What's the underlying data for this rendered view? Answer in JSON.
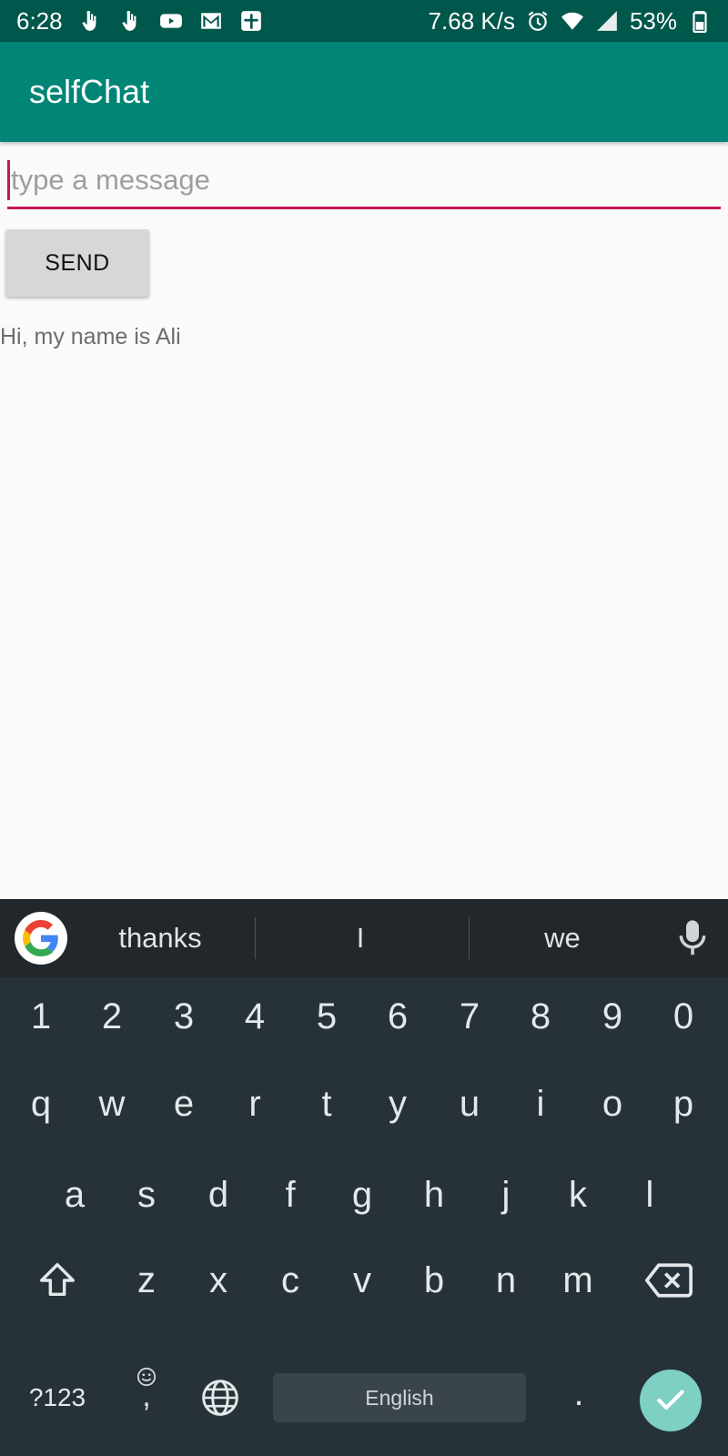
{
  "status_bar": {
    "time": "6:28",
    "net_speed": "7.68 K/s",
    "battery": "53%",
    "left_icons": [
      "touch-icon",
      "touch-icon",
      "youtube-icon",
      "gmail-icon",
      "calendar-icon"
    ],
    "right_icons": [
      "alarm-icon",
      "wifi-icon",
      "signal-icon",
      "battery-icon"
    ]
  },
  "app_bar": {
    "title": "selfChat"
  },
  "composer": {
    "placeholder": "type a message",
    "value": "",
    "send_label": "SEND"
  },
  "messages": [
    {
      "text": "Hi, my name is Ali"
    }
  ],
  "keyboard": {
    "suggestions": [
      "thanks",
      "I",
      "we"
    ],
    "row_numbers": [
      "1",
      "2",
      "3",
      "4",
      "5",
      "6",
      "7",
      "8",
      "9",
      "0"
    ],
    "row_1": [
      "q",
      "w",
      "e",
      "r",
      "t",
      "y",
      "u",
      "i",
      "o",
      "p"
    ],
    "row_2": [
      "a",
      "s",
      "d",
      "f",
      "g",
      "h",
      "j",
      "k",
      "l"
    ],
    "row_3": [
      "z",
      "x",
      "c",
      "v",
      "b",
      "n",
      "m"
    ],
    "symbols_label": "?123",
    "comma_label": ",",
    "space_label": "English",
    "period_label": "."
  },
  "colors": {
    "status_bar": "#00574b",
    "app_bar": "#008577",
    "accent": "#c2185b",
    "keyboard_bg": "#263238",
    "enter_key": "#7ecfc4"
  }
}
